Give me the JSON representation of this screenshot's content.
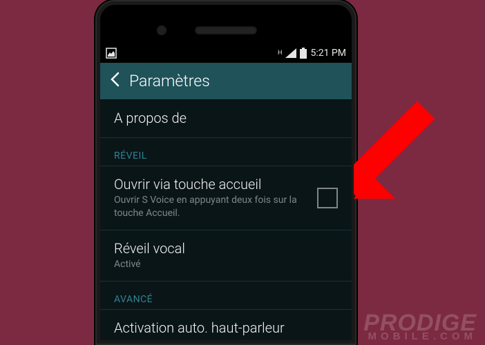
{
  "statusbar": {
    "network_label": "H",
    "time": "5:21 PM"
  },
  "header": {
    "title": "Paramètres"
  },
  "rows": {
    "about_title": "A propos de",
    "section_reveil": "RÉVEIL",
    "open_home_title": "Ouvrir via touche accueil",
    "open_home_sub": "Ouvrir S Voice en appuyant deux fois sur la touche Accueil.",
    "voice_wake_title": "Réveil vocal",
    "voice_wake_sub": "Activé",
    "section_advanced": "AVANCÉ",
    "auto_speaker_title": "Activation auto. haut-parleur"
  },
  "watermark": {
    "main": "PRODIGE",
    "sub": "MOBILE.COM"
  }
}
